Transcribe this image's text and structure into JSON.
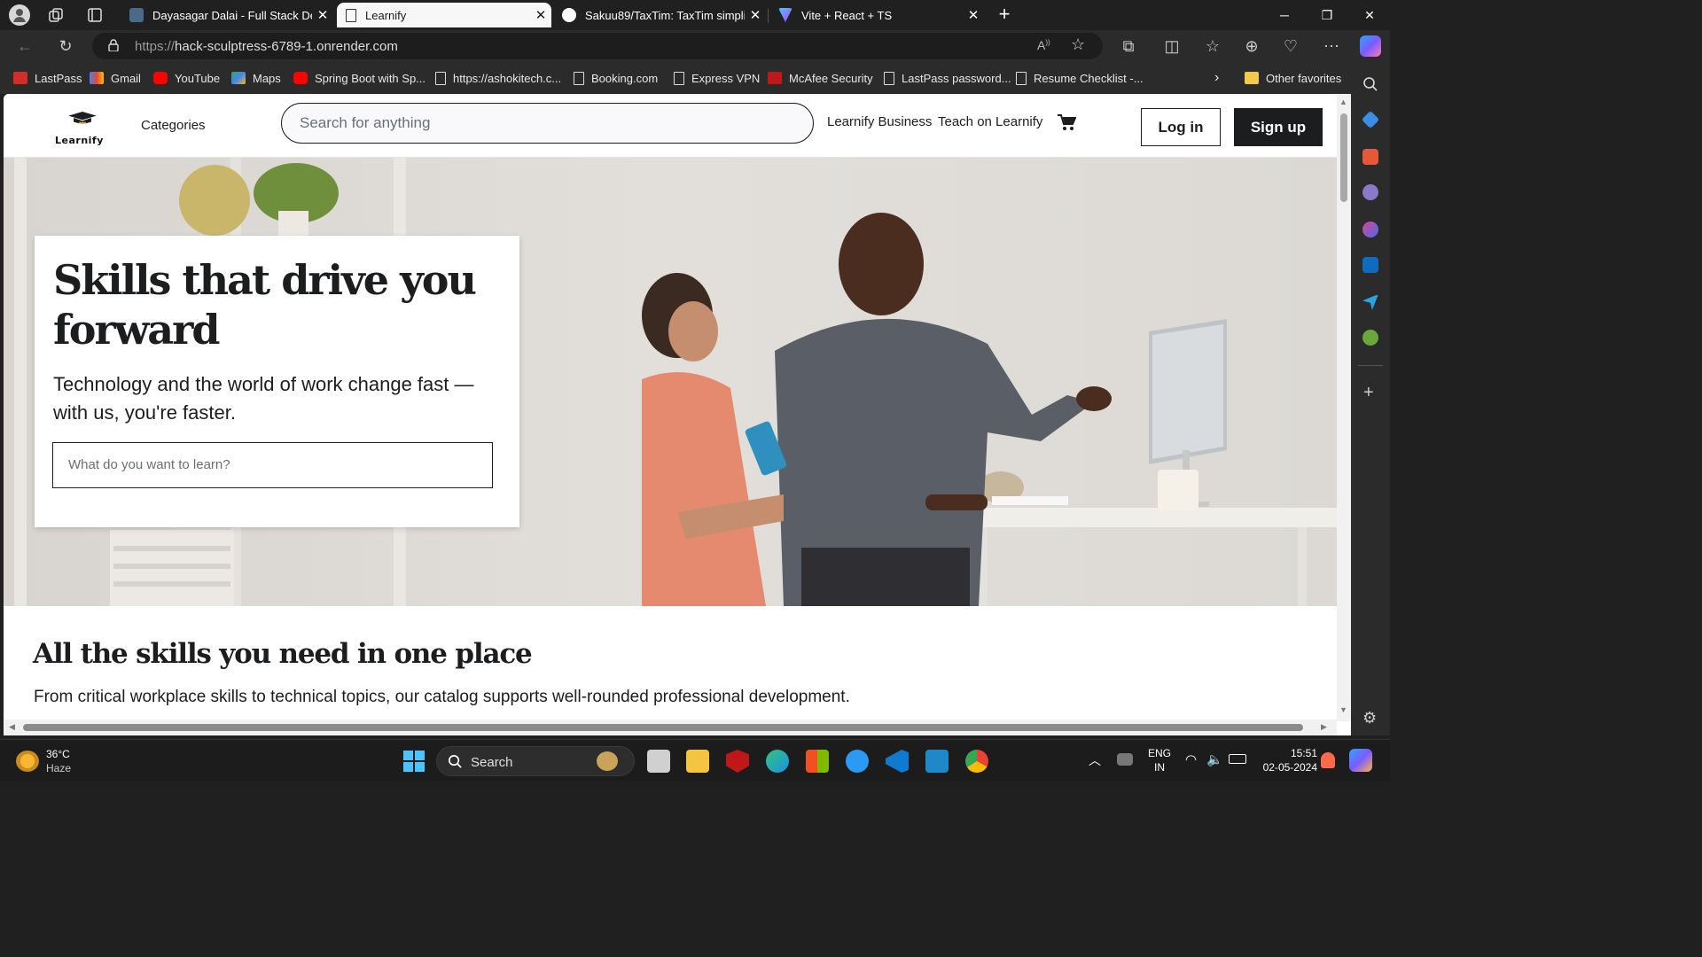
{
  "browser": {
    "tabs": [
      {
        "title": "Dayasagar Dalai - Full Stack Deve",
        "active": false
      },
      {
        "title": "Learnify",
        "active": true
      },
      {
        "title": "Sakuu89/TaxTim: TaxTim simplifie",
        "active": false
      },
      {
        "title": "Vite + React + TS",
        "active": false
      }
    ],
    "url_protocol": "https://",
    "url_host": "hack-sculptress-6789-1.onrender.com",
    "favorites": [
      "LastPass",
      "Gmail",
      "YouTube",
      "Maps",
      "Spring Boot with Sp...",
      "https://ashokitech.c...",
      "Booking.com",
      "Express VPN",
      "McAfee Security",
      "LastPass password...",
      "Resume Checklist -..."
    ],
    "other_favorites": "Other favorites"
  },
  "site": {
    "logo_text": "Learnify",
    "categories": "Categories",
    "search_placeholder": "Search for anything",
    "business_link": "Learnify Business",
    "teach_link": "Teach on Learnify",
    "login": "Log in",
    "signup": "Sign up"
  },
  "hero": {
    "title": "Skills that drive you forward",
    "subtitle": "Technology and the world of work change fast — with us, you're faster.",
    "input_placeholder": "What do you want to learn?"
  },
  "section": {
    "title": "All the skills you need in one place",
    "description": "From critical workplace skills to technical topics, our catalog supports well-rounded professional development."
  },
  "taskbar": {
    "weather_temp": "36°C",
    "weather_desc": "Haze",
    "search_label": "Search",
    "lang_line1": "ENG",
    "lang_line2": "IN",
    "time": "15:51",
    "date": "02-05-2024"
  },
  "colors": {
    "accent_dark": "#1c1d1f",
    "browser_chrome": "#202020",
    "hero_bg": "#dedbd6"
  }
}
